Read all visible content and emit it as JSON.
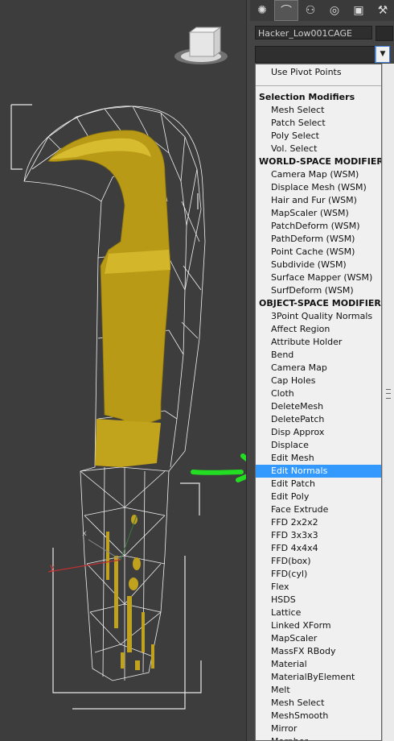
{
  "object_name": "Hacker_Low001CAGE",
  "tabs": [
    {
      "name": "sun-icon",
      "glyph": "✺"
    },
    {
      "name": "curve-icon",
      "glyph": "⌒"
    },
    {
      "name": "hierarchy-icon",
      "glyph": "⚇"
    },
    {
      "name": "motion-icon",
      "glyph": "◎"
    },
    {
      "name": "display-icon",
      "glyph": "▣"
    },
    {
      "name": "hammer-icon",
      "glyph": "⚒"
    }
  ],
  "top_option": "Use Pivot Points",
  "list": [
    {
      "type": "header",
      "label": "Selection Modifiers"
    },
    {
      "type": "item",
      "label": "Mesh Select"
    },
    {
      "type": "item",
      "label": "Patch Select"
    },
    {
      "type": "item",
      "label": "Poly Select"
    },
    {
      "type": "item",
      "label": "Vol. Select"
    },
    {
      "type": "header",
      "label": "WORLD-SPACE MODIFIERS"
    },
    {
      "type": "item",
      "label": "Camera Map (WSM)"
    },
    {
      "type": "item",
      "label": "Displace Mesh (WSM)"
    },
    {
      "type": "item",
      "label": "Hair and Fur (WSM)"
    },
    {
      "type": "item",
      "label": "MapScaler (WSM)"
    },
    {
      "type": "item",
      "label": "PatchDeform (WSM)"
    },
    {
      "type": "item",
      "label": "PathDeform (WSM)"
    },
    {
      "type": "item",
      "label": "Point Cache (WSM)"
    },
    {
      "type": "item",
      "label": "Subdivide (WSM)"
    },
    {
      "type": "item",
      "label": "Surface Mapper (WSM)"
    },
    {
      "type": "item",
      "label": "SurfDeform (WSM)"
    },
    {
      "type": "header",
      "label": "OBJECT-SPACE MODIFIERS"
    },
    {
      "type": "item",
      "label": "3Point Quality Normals"
    },
    {
      "type": "item",
      "label": "Affect Region"
    },
    {
      "type": "item",
      "label": "Attribute Holder"
    },
    {
      "type": "item",
      "label": "Bend"
    },
    {
      "type": "item",
      "label": "Camera Map"
    },
    {
      "type": "item",
      "label": "Cap Holes"
    },
    {
      "type": "item",
      "label": "Cloth"
    },
    {
      "type": "item",
      "label": "DeleteMesh"
    },
    {
      "type": "item",
      "label": "DeletePatch"
    },
    {
      "type": "item",
      "label": "Disp Approx"
    },
    {
      "type": "item",
      "label": "Displace"
    },
    {
      "type": "item",
      "label": "Edit Mesh"
    },
    {
      "type": "item",
      "label": "Edit Normals",
      "selected": true
    },
    {
      "type": "item",
      "label": "Edit Patch"
    },
    {
      "type": "item",
      "label": "Edit Poly"
    },
    {
      "type": "item",
      "label": "Face Extrude"
    },
    {
      "type": "item",
      "label": "FFD 2x2x2"
    },
    {
      "type": "item",
      "label": "FFD 3x3x3"
    },
    {
      "type": "item",
      "label": "FFD 4x4x4"
    },
    {
      "type": "item",
      "label": "FFD(box)"
    },
    {
      "type": "item",
      "label": "FFD(cyl)"
    },
    {
      "type": "item",
      "label": "Flex"
    },
    {
      "type": "item",
      "label": "HSDS"
    },
    {
      "type": "item",
      "label": "Lattice"
    },
    {
      "type": "item",
      "label": "Linked XForm"
    },
    {
      "type": "item",
      "label": "MapScaler"
    },
    {
      "type": "item",
      "label": "MassFX RBody"
    },
    {
      "type": "item",
      "label": "Material"
    },
    {
      "type": "item",
      "label": "MaterialByElement"
    },
    {
      "type": "item",
      "label": "Melt"
    },
    {
      "type": "item",
      "label": "Mesh Select"
    },
    {
      "type": "item",
      "label": "MeshSmooth"
    },
    {
      "type": "item",
      "label": "Mirror"
    },
    {
      "type": "item",
      "label": "Morpher"
    }
  ],
  "axes": {
    "x": "x",
    "y": "y"
  },
  "colors": {
    "selection": "#3399ff",
    "annotation_arrow": "#22dd22",
    "mesh": "#c8a820"
  }
}
